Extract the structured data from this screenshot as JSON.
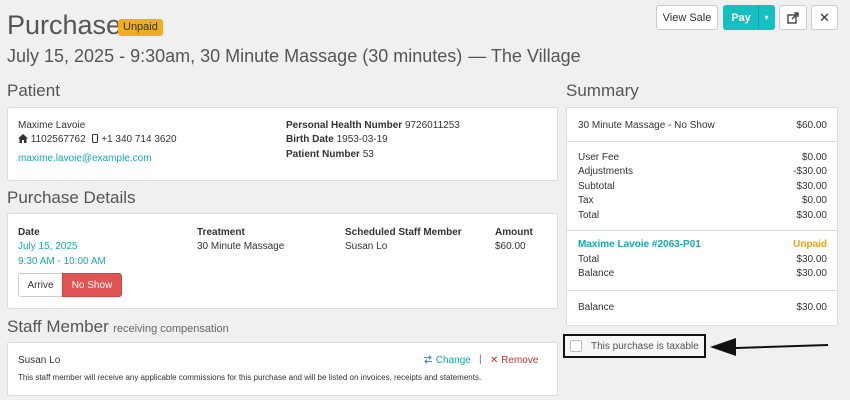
{
  "header": {
    "title": "Purchase",
    "status_badge": "Unpaid",
    "subtitle": "July 15, 2025 - 9:30am, 30 Minute Massage (30 minutes)",
    "location": "— The Village"
  },
  "toolbar": {
    "view_sale_label": "View Sale",
    "pay_label": "Pay",
    "pay_caret": "▾",
    "share_glyph": "⇗",
    "close_glyph": "✕"
  },
  "patient": {
    "section_title": "Patient",
    "name": "Maxime Lavoie",
    "home_phone": "1102567762",
    "mobile_phone": "+1 340 714 3620",
    "email": "maxime.lavoie@example.com",
    "phn_label": "Personal Health Number",
    "phn_value": "9726011253",
    "birth_label": "Birth Date",
    "birth_value": "1953-03-19",
    "patient_no_label": "Patient Number",
    "patient_no_value": "53"
  },
  "purchase_details": {
    "section_title": "Purchase Details",
    "columns": [
      "Date",
      "Treatment",
      "Scheduled Staff Member",
      "Amount"
    ],
    "date": "July 15, 2025",
    "time": "9:30 AM - 10:00 AM",
    "treatment": "30 Minute Massage",
    "staff": "Susan Lo",
    "amount": "$60.00",
    "arrive_label": "Arrive",
    "no_show_label": "No Show"
  },
  "staff_member": {
    "section_title": "Staff Member",
    "section_subtitle": "receiving compensation",
    "name": "Susan Lo",
    "change_label": "Change",
    "separator": "|",
    "remove_label": "Remove",
    "note": "This staff member will receive any applicable commissions for this purchase and will be listed on invoices, receipts and statements."
  },
  "summary": {
    "section_title": "Summary",
    "item": {
      "label": "30 Minute Massage - No Show",
      "value": "$60.00"
    },
    "fees": [
      {
        "label": "User Fee",
        "value": "$0.00"
      },
      {
        "label": "Adjustments",
        "value": "-$30.00"
      },
      {
        "label": "Subtotal",
        "value": "$30.00"
      },
      {
        "label": "Tax",
        "value": "$0.00"
      },
      {
        "label": "Total",
        "value": "$30.00"
      }
    ],
    "payer": {
      "label": "Maxime Lavoie #2063-P01",
      "status": "Unpaid"
    },
    "payer_rows": [
      {
        "label": "Total",
        "value": "$30.00"
      },
      {
        "label": "Balance",
        "value": "$30.00"
      }
    ],
    "balance": {
      "label": "Balance",
      "value": "$30.00"
    }
  },
  "taxable": {
    "label": "This purchase is taxable",
    "checked": false
  },
  "colors": {
    "accent": "#17c0c0",
    "link": "#17a7b5",
    "unpaid_badge": "#f0ad1e",
    "no_show": "#e05454",
    "remove": "#c0392b"
  }
}
